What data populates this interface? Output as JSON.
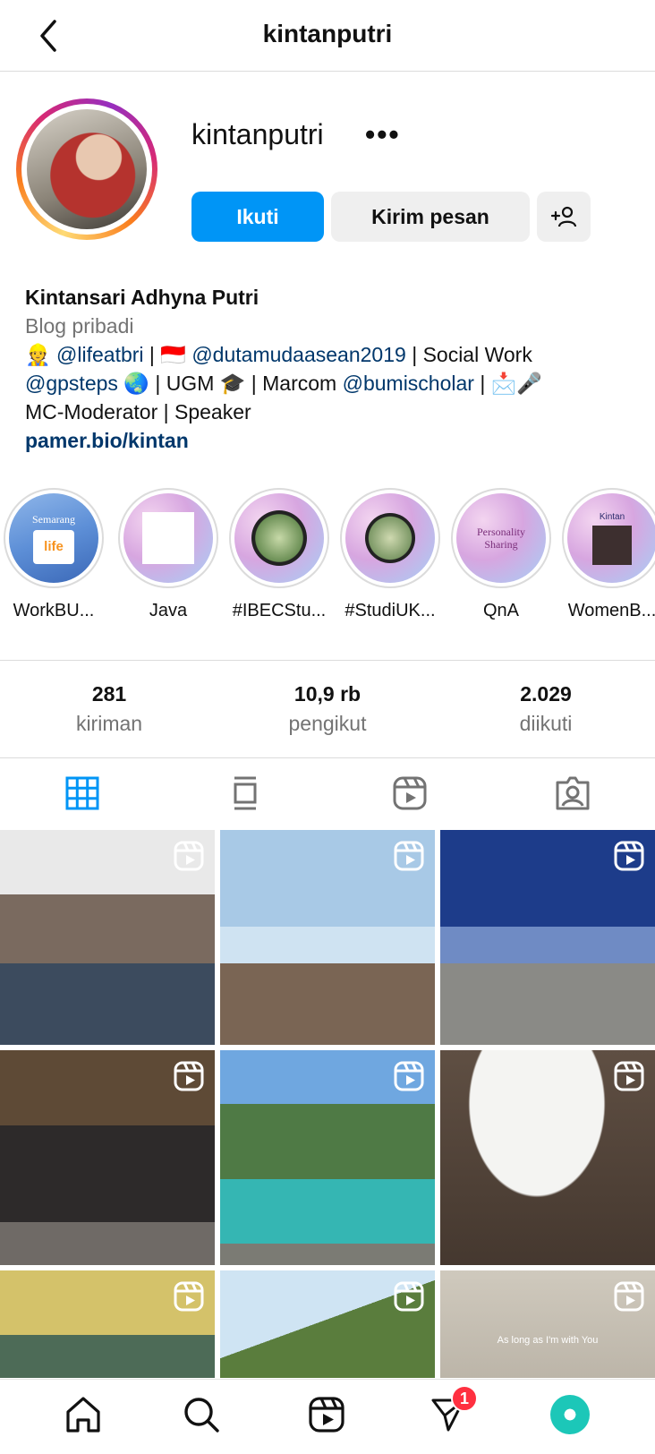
{
  "header": {
    "title": "kintanputri"
  },
  "profile": {
    "username": "kintanputri",
    "follow_label": "Ikuti",
    "message_label": "Kirim pesan",
    "name": "Kintansari Adhyna Putri",
    "category": "Blog pribadi",
    "bio_line1_a": "@lifeatbri",
    "bio_line1_sep": " | ",
    "bio_line1_b": "@dutamudaasean2019",
    "bio_line1_c": " | Social Work",
    "bio_line2_a": "@gpsteps",
    "bio_line2_b": " | UGM ",
    "bio_line2_c": " | Marcom ",
    "bio_line2_d": "@bumischolar",
    "bio_line2_e": " | ",
    "bio_line3": "MC-Moderator | Speaker",
    "link": "pamer.bio/kintan"
  },
  "highlights": [
    {
      "label": "WorkBU...",
      "cover_text": "Semarang"
    },
    {
      "label": "Java",
      "cover_text": ""
    },
    {
      "label": "#IBECStu...",
      "cover_text": ""
    },
    {
      "label": "#StudiUK...",
      "cover_text": ""
    },
    {
      "label": "QnA",
      "cover_text": "Personality Sharing"
    },
    {
      "label": "WomenB...",
      "cover_text": "Kintan"
    }
  ],
  "stats": {
    "posts_count": "281",
    "posts_label": "kiriman",
    "followers_count": "10,9 rb",
    "followers_label": "pengikut",
    "following_count": "2.029",
    "following_label": "diikuti"
  },
  "grid_caption": "As long as I'm with You",
  "nav": {
    "messages_badge": "1"
  },
  "colors": {
    "primary": "#0095f6",
    "secondary_bg": "#efefef",
    "link": "#00376b",
    "badge": "#ff3040"
  }
}
